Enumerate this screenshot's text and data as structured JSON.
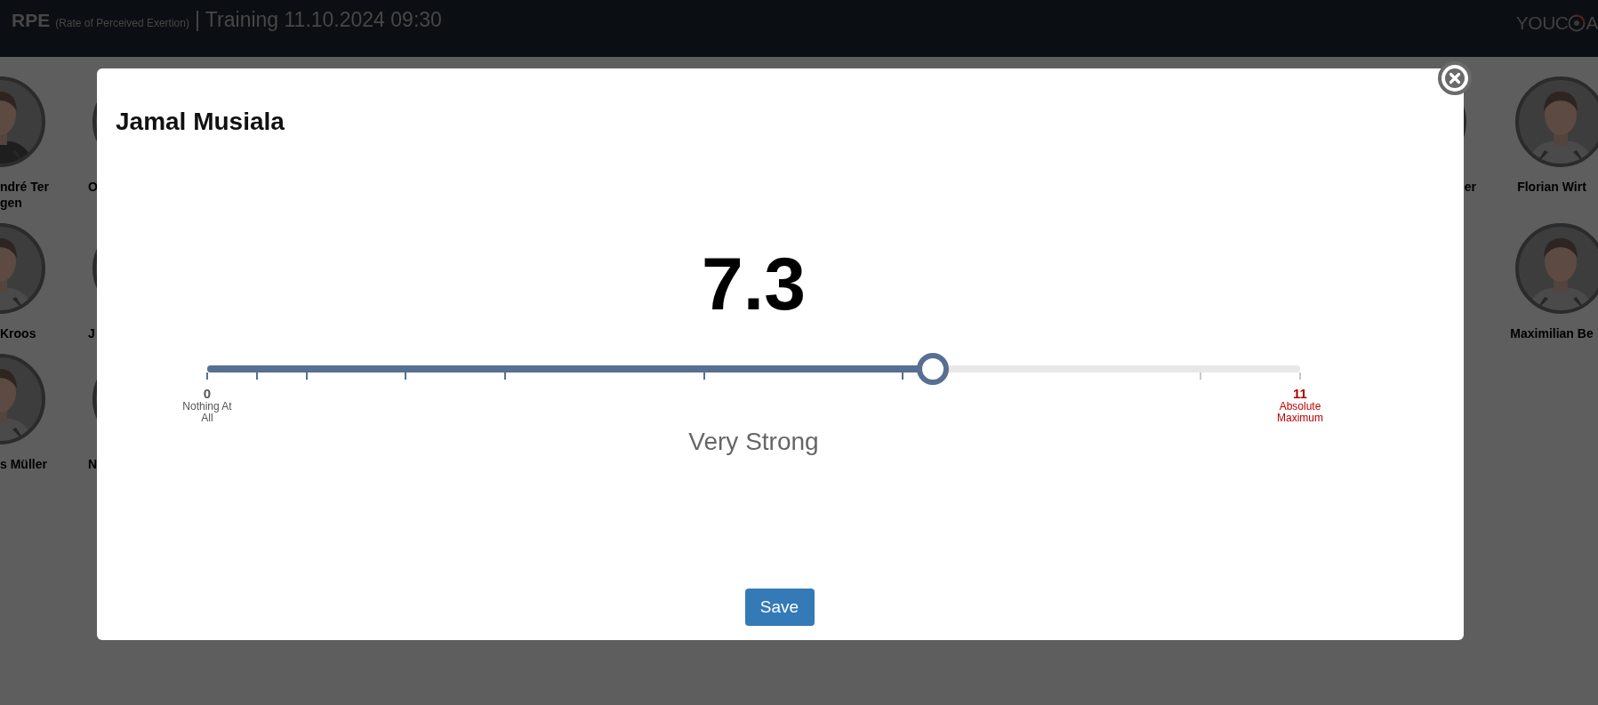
{
  "header": {
    "title": "RPE",
    "subtitle": "(Rate of Perceived Exertion)",
    "session": "| Training 11.10.2024 09:30",
    "logo": {
      "text_before": "YOUC",
      "text_after": "A"
    }
  },
  "background_left": [
    {
      "players": [
        {
          "name": "ndré Ter gen"
        },
        {
          "name": "Kroos"
        },
        {
          "name": "s Müller"
        }
      ]
    },
    {
      "players": [
        {
          "name": "O"
        },
        {
          "name": "J"
        },
        {
          "name": "N"
        }
      ]
    }
  ],
  "background_right": [
    {
      "players": [
        {
          "name": "er"
        }
      ]
    },
    {
      "players": [
        {
          "name": "Florian Wirt"
        },
        {
          "name": "Maximilian Be"
        }
      ]
    }
  ],
  "dialog": {
    "title": "Jamal Musiala",
    "value": "7.3",
    "rating": {
      "level": 0.6636,
      "min_value": "0",
      "min_label": "Nothing At All",
      "max_value": "11",
      "max_label": "Absolute Maximum"
    },
    "description": "Very Strong",
    "save_button": "Save"
  }
}
